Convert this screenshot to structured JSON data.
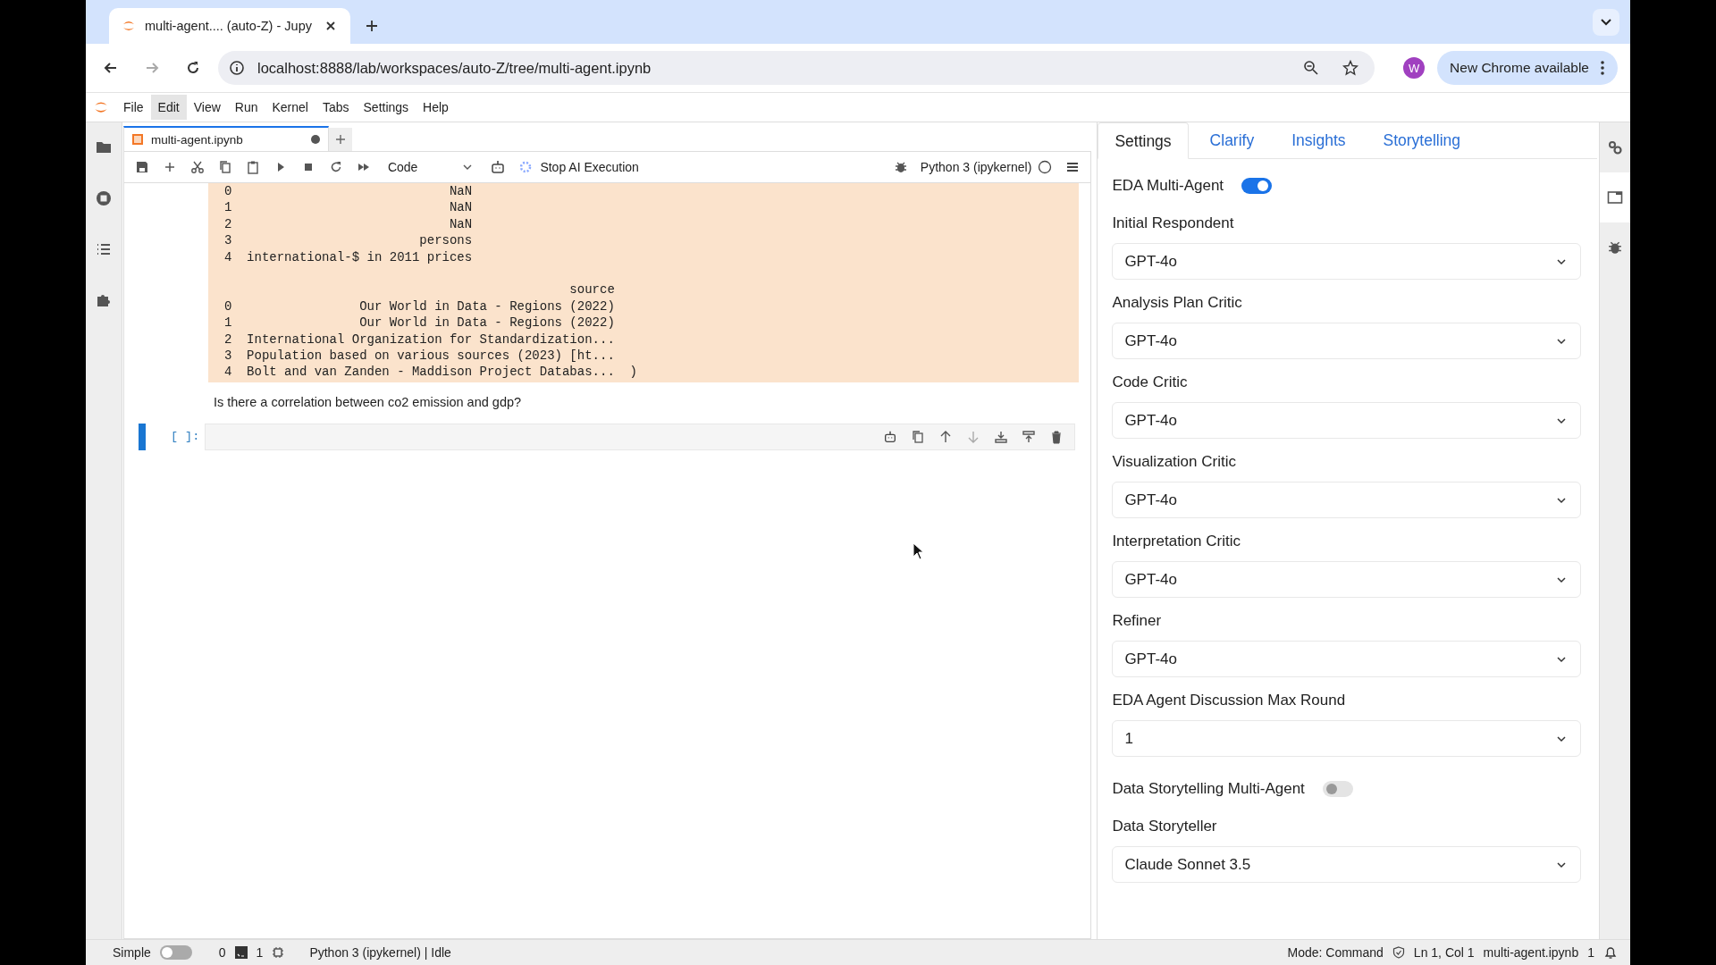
{
  "browser": {
    "tab_title": "multi-agent.... (auto-Z) - Jupy",
    "address": "localhost:8888/lab/workspaces/auto-Z/tree/multi-agent.ipynb",
    "profile_initial": "W",
    "update_button": "New Chrome available"
  },
  "menu": [
    {
      "label": "File",
      "selected": false
    },
    {
      "label": "Edit",
      "selected": true
    },
    {
      "label": "View",
      "selected": false
    },
    {
      "label": "Run",
      "selected": false
    },
    {
      "label": "Kernel",
      "selected": false
    },
    {
      "label": "Tabs",
      "selected": false
    },
    {
      "label": "Settings",
      "selected": false
    },
    {
      "label": "Help",
      "selected": false
    }
  ],
  "notebook": {
    "tab_title": "multi-agent.ipynb",
    "unsaved": true,
    "cell_type": "Code",
    "ai_button": "Stop AI Execution",
    "kernel": "Python 3 (ipykernel)",
    "output_blocks": [
      [
        "0                             NaN",
        "1                             NaN",
        "2                             NaN",
        "3                         persons",
        "4  international-$ in 2011 prices"
      ],
      [
        "                                              source",
        "0                 Our World in Data - Regions (2022)",
        "1                 Our World in Data - Regions (2022)",
        "2  International Organization for Standardization...",
        "3  Population based on various sources (2023) [ht...",
        "4  Bolt and van Zanden - Maddison Project Databas...  )"
      ]
    ],
    "message": "Is there a correlation between co2 emission and gdp?",
    "prompt": "[ ]:"
  },
  "panel": {
    "tabs": [
      {
        "label": "Settings",
        "selected": true
      },
      {
        "label": "Clarify",
        "selected": false
      },
      {
        "label": "Insights",
        "selected": false
      },
      {
        "label": "Storytelling",
        "selected": false
      }
    ],
    "fields": [
      {
        "kind": "toggle",
        "label": "EDA Multi-Agent",
        "on": true
      },
      {
        "kind": "select",
        "label": "Initial Respondent",
        "value": "GPT-4o"
      },
      {
        "kind": "select",
        "label": "Analysis Plan Critic",
        "value": "GPT-4o"
      },
      {
        "kind": "select",
        "label": "Code Critic",
        "value": "GPT-4o"
      },
      {
        "kind": "select",
        "label": "Visualization Critic",
        "value": "GPT-4o"
      },
      {
        "kind": "select",
        "label": "Interpretation Critic",
        "value": "GPT-4o"
      },
      {
        "kind": "select",
        "label": "Refiner",
        "value": "GPT-4o"
      },
      {
        "kind": "select",
        "label": "EDA Agent Discussion Max Round",
        "value": "1"
      },
      {
        "kind": "toggle",
        "label": "Data Storytelling Multi-Agent",
        "on": false
      },
      {
        "kind": "select",
        "label": "Data Storyteller",
        "value": "Claude Sonnet 3.5"
      }
    ]
  },
  "status_bar": {
    "simple_label": "Simple",
    "simple_on": false,
    "terminals": "0",
    "kernels": "1",
    "kernel_status": "Python 3 (ipykernel) | Idle",
    "mode": "Mode: Command",
    "position": "Ln 1, Col 1",
    "file": "multi-agent.ipynb",
    "notifications": "1"
  }
}
